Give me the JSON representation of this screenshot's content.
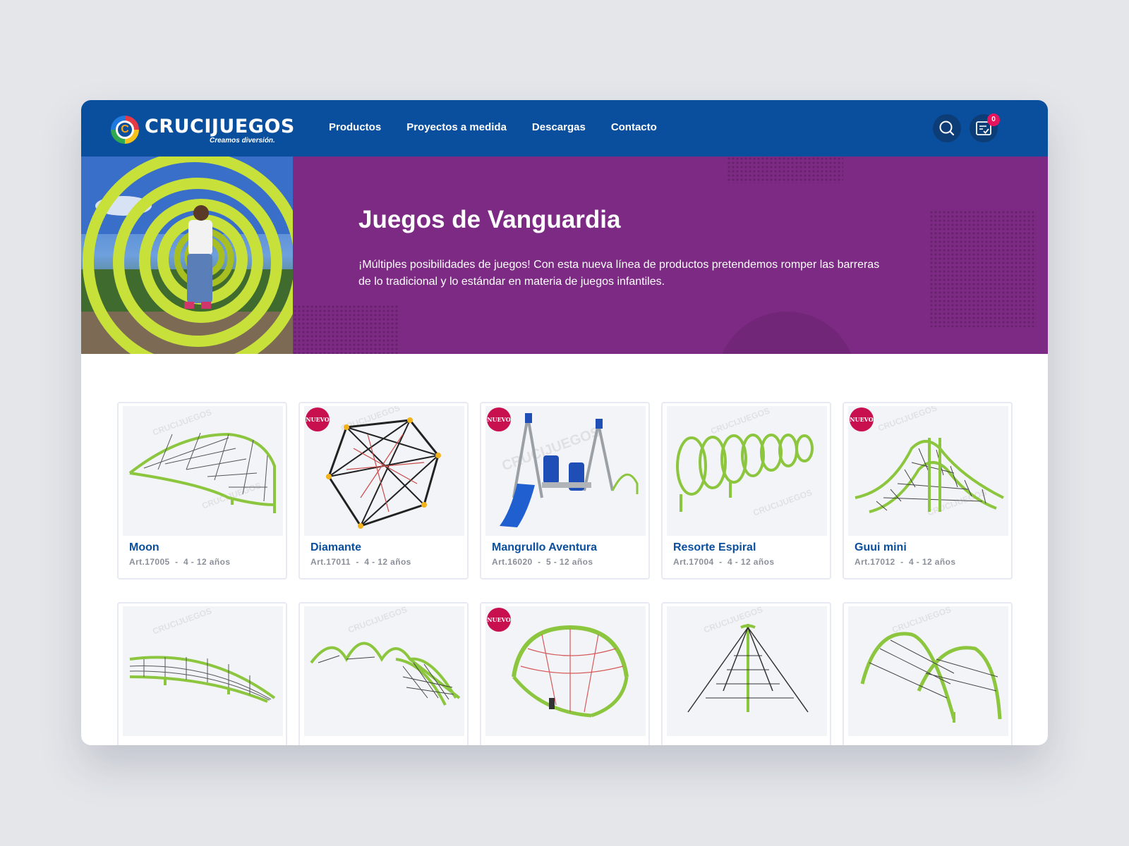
{
  "brand": {
    "name": "CRUCIJUEGOS",
    "tagline": "Creamos diversión.",
    "mark": "C"
  },
  "nav": {
    "items": [
      "Productos",
      "Proyectos a medida",
      "Descargas",
      "Contacto"
    ]
  },
  "header": {
    "cart_count": "0",
    "search_icon": "search-icon",
    "cart_icon": "checklist-cart-icon"
  },
  "hero": {
    "title": "Juegos de Vanguardia",
    "description": "¡Múltiples posibilidades de juegos! Con esta nueva línea de productos pretendemos romper las barreras de lo tradicional y lo estándar en materia de juegos infantiles."
  },
  "badge_label": "NUEVO",
  "watermark": "CRUCIJUEGOS",
  "products": [
    {
      "name": "Moon",
      "art": "Art.17005",
      "ages": "4 - 12 años",
      "nuevo": false,
      "illustration": "curved-net-arch"
    },
    {
      "name": "Diamante",
      "art": "Art.17011",
      "ages": "4 - 12 años",
      "nuevo": true,
      "illustration": "geodesic-net"
    },
    {
      "name": "Mangrullo Aventura",
      "art": "Art.16020",
      "ages": "5 - 12 años",
      "nuevo": true,
      "illustration": "tower-slide"
    },
    {
      "name": "Resorte Espiral",
      "art": "Art.17004",
      "ages": "4 - 12 años",
      "nuevo": false,
      "illustration": "spiral-spring"
    },
    {
      "name": "Guui mini",
      "art": "Art.17012",
      "ages": "4 - 12 años",
      "nuevo": true,
      "illustration": "net-bridge"
    },
    {
      "name": "",
      "art": "",
      "ages": "",
      "nuevo": false,
      "illustration": "curved-net-low"
    },
    {
      "name": "",
      "art": "",
      "ages": "",
      "nuevo": false,
      "illustration": "wave-net"
    },
    {
      "name": "",
      "art": "",
      "ages": "",
      "nuevo": true,
      "illustration": "dome-net"
    },
    {
      "name": "",
      "art": "",
      "ages": "",
      "nuevo": false,
      "illustration": "pyramid-net"
    },
    {
      "name": "",
      "art": "",
      "ages": "",
      "nuevo": false,
      "illustration": "double-arch-net"
    }
  ],
  "colors": {
    "header": "#0a4f9e",
    "hero": "#7c2a83",
    "accent_green": "#8cc63f",
    "badge": "#c8104f"
  }
}
